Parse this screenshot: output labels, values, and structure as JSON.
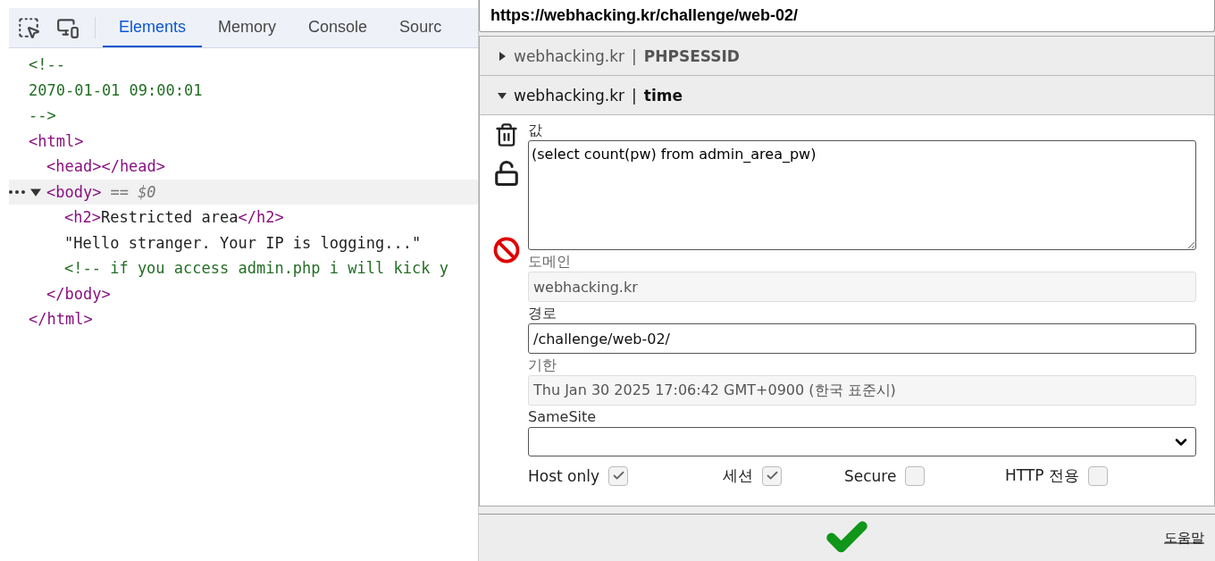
{
  "devtools": {
    "tabs": [
      {
        "label": "Elements",
        "selected": true
      },
      {
        "label": "Memory",
        "selected": false
      },
      {
        "label": "Console",
        "selected": false
      },
      {
        "label": "Sourc",
        "selected": false
      }
    ],
    "tree": [
      {
        "tokens": [
          {
            "kind": "comment",
            "text": "<!--"
          }
        ]
      },
      {
        "tokens": [
          {
            "kind": "comment",
            "text": "2070-01-01 09:00:01"
          }
        ]
      },
      {
        "tokens": [
          {
            "kind": "comment",
            "text": "-->"
          }
        ]
      },
      {
        "tokens": [
          {
            "kind": "tag",
            "text": "<html>"
          }
        ],
        "selected": false,
        "closing": [
          {
            "kind": "tag",
            "text": "</html>"
          }
        ],
        "children": [
          {
            "tokens": [
              {
                "kind": "tag",
                "text": "<head></head>"
              }
            ]
          },
          {
            "tokens": [
              {
                "kind": "tag",
                "text": "<body>"
              },
              {
                "kind": "hint",
                "text": "== $0"
              }
            ],
            "selected": true,
            "expanded": true,
            "closing": [
              {
                "kind": "tag",
                "text": "</body>"
              }
            ],
            "children": [
              {
                "tokens": [
                  {
                    "kind": "tag",
                    "text": "<h2>"
                  },
                  {
                    "kind": "text",
                    "text": "Restricted area"
                  },
                  {
                    "kind": "tag",
                    "text": "</h2>"
                  }
                ]
              },
              {
                "tokens": [
                  {
                    "kind": "text",
                    "text": "\"Hello stranger. Your IP is logging...\""
                  }
                ]
              },
              {
                "tokens": [
                  {
                    "kind": "comment",
                    "text": "<!-- if you access admin.php i will kick y"
                  }
                ]
              }
            ]
          }
        ]
      }
    ]
  },
  "cookie_editor": {
    "url": "https://webhacking.kr/challenge/web-02/",
    "cookies": [
      {
        "domain": "webhacking.kr",
        "separator": "|",
        "name": "PHPSESSID",
        "expanded": false
      },
      {
        "domain": "webhacking.kr",
        "separator": "|",
        "name": "time",
        "expanded": true
      }
    ],
    "fields": [
      {
        "kind": "textarea",
        "label": "값",
        "value": "(select count(pw) from admin_area_pw)",
        "disabled": false
      },
      {
        "kind": "input",
        "label": "도메인",
        "value": "webhacking.kr",
        "disabled": true
      },
      {
        "kind": "input",
        "label": "경로",
        "value": "/challenge/web-02/",
        "disabled": false
      },
      {
        "kind": "input",
        "label": "기한",
        "value": "Thu Jan 30 2025 17:06:42 GMT+0900 (한국 표준시)",
        "disabled": true
      },
      {
        "kind": "select",
        "label": "SameSite",
        "disabled": false
      }
    ],
    "flags": [
      {
        "label": "Host only",
        "checked": true
      },
      {
        "label": "세션",
        "checked": true
      },
      {
        "label": "Secure",
        "checked": false
      },
      {
        "label": "HTTP 전용",
        "checked": false
      }
    ],
    "help_link": "도움말"
  }
}
